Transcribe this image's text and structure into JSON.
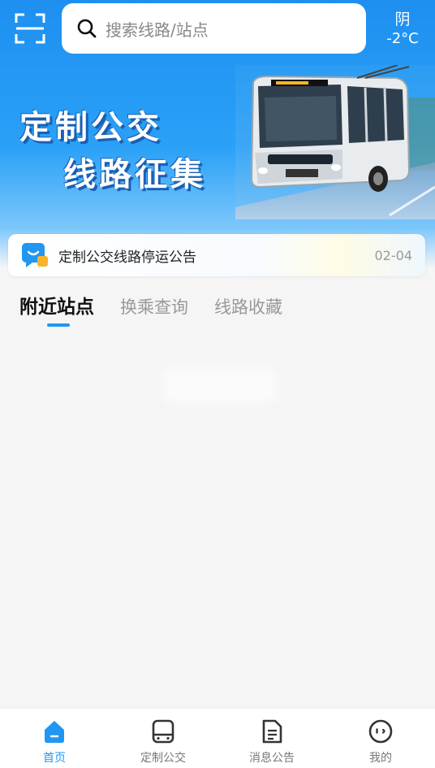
{
  "header": {
    "scan_icon": "scan-icon",
    "search": {
      "placeholder": "搜索线路/站点",
      "icon": "search-icon"
    },
    "weather": {
      "condition": "阴",
      "temperature": "-2°C"
    }
  },
  "banner": {
    "line1": "定制公交",
    "line2": "线路征集"
  },
  "notice": {
    "icon": "message-icon",
    "title": "定制公交线路停运公告",
    "date": "02-04"
  },
  "tabs": [
    {
      "label": "附近站点",
      "active": true
    },
    {
      "label": "换乘查询",
      "active": false
    },
    {
      "label": "线路收藏",
      "active": false
    }
  ],
  "bottom_nav": [
    {
      "label": "首页",
      "icon": "home-icon",
      "active": true
    },
    {
      "label": "定制公交",
      "icon": "bus-icon",
      "active": false
    },
    {
      "label": "消息公告",
      "icon": "document-icon",
      "active": false
    },
    {
      "label": "我的",
      "icon": "profile-icon",
      "active": false
    }
  ],
  "colors": {
    "primary": "#2196f3",
    "header_top": "#1e8ff0"
  }
}
